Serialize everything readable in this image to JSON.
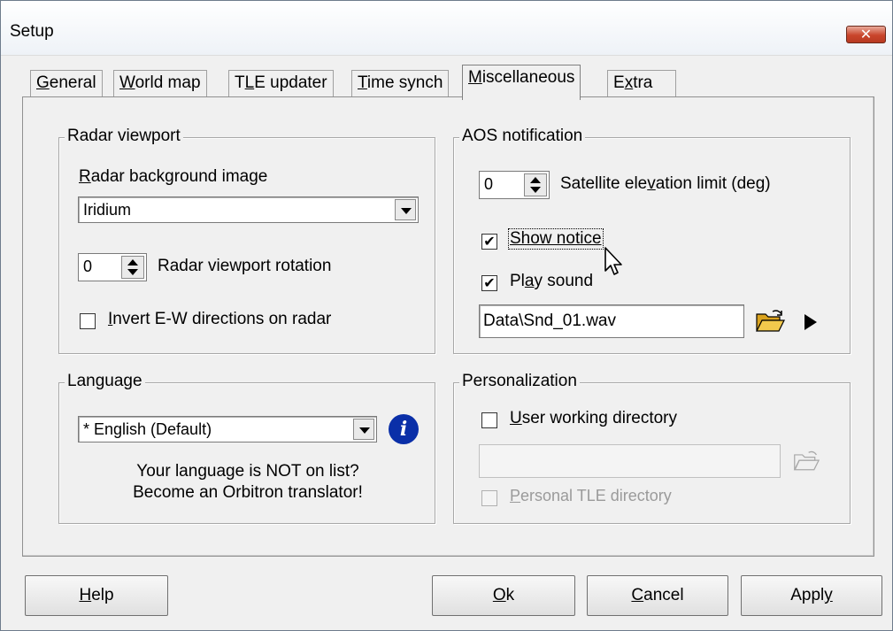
{
  "window": {
    "title": "Setup",
    "close_glyph": "✕"
  },
  "tabs": [
    {
      "label": "General",
      "ul": "G",
      "rest": "eneral",
      "active": false
    },
    {
      "label": "World map",
      "ul": "W",
      "rest": "orld map",
      "active": false
    },
    {
      "label": "TLE updater",
      "pre": "T",
      "ul": "L",
      "rest": "E updater",
      "active": false
    },
    {
      "label": "Time synch",
      "ul": "T",
      "rest": "ime synch",
      "active": false
    },
    {
      "label": "Miscellaneous",
      "ul": "M",
      "rest": "iscellaneous",
      "active": true
    },
    {
      "label": "Extra",
      "pre": "E",
      "ul": "x",
      "rest": "tra",
      "active": false
    }
  ],
  "radar": {
    "legend": "Radar viewport",
    "bg_label_ul": "R",
    "bg_label_rest": "adar background image",
    "bg_value": "Iridium",
    "rotation_value": "0",
    "rotation_label": "Radar viewport rotation",
    "invert_checked": false,
    "invert_ul": "I",
    "invert_rest": "nvert E-W directions on radar"
  },
  "aos": {
    "legend": "AOS notification",
    "elev_value": "0",
    "elev_pre": "Satellite ele",
    "elev_ul": "v",
    "elev_rest": "ation limit (deg)",
    "show_notice_checked": true,
    "show_notice_label": "Show notice",
    "play_sound_checked": true,
    "play_pre": "Pl",
    "play_ul": "a",
    "play_rest": "y sound",
    "sound_file": "Data\\Snd_01.wav",
    "check_glyph": "✔",
    "browse_icon": "open-folder-icon",
    "play_icon": "play-icon"
  },
  "language": {
    "legend": "Language",
    "value": "* English (Default)",
    "note_line1": "Your language is NOT on list?",
    "note_line2": "Become an Orbitron translator!",
    "info_glyph": "i"
  },
  "personalization": {
    "legend": "Personalization",
    "user_dir_checked": false,
    "user_dir_ul": "U",
    "user_dir_rest": "ser working directory",
    "user_dir_value": "",
    "tle_dir_checked": false,
    "tle_dir_ul": "P",
    "tle_dir_rest": "ersonal TLE directory"
  },
  "buttons": {
    "help_ul": "H",
    "help_rest": "elp",
    "ok_ul": "O",
    "ok_rest": "k",
    "cancel_ul": "C",
    "cancel_rest": "ancel",
    "apply_pre": "Appl",
    "apply_ul": "y"
  },
  "colors": {
    "info_blue": "#0a2fa8",
    "close_red": "#c9452b",
    "folder_yellow": "#f2c94c"
  }
}
